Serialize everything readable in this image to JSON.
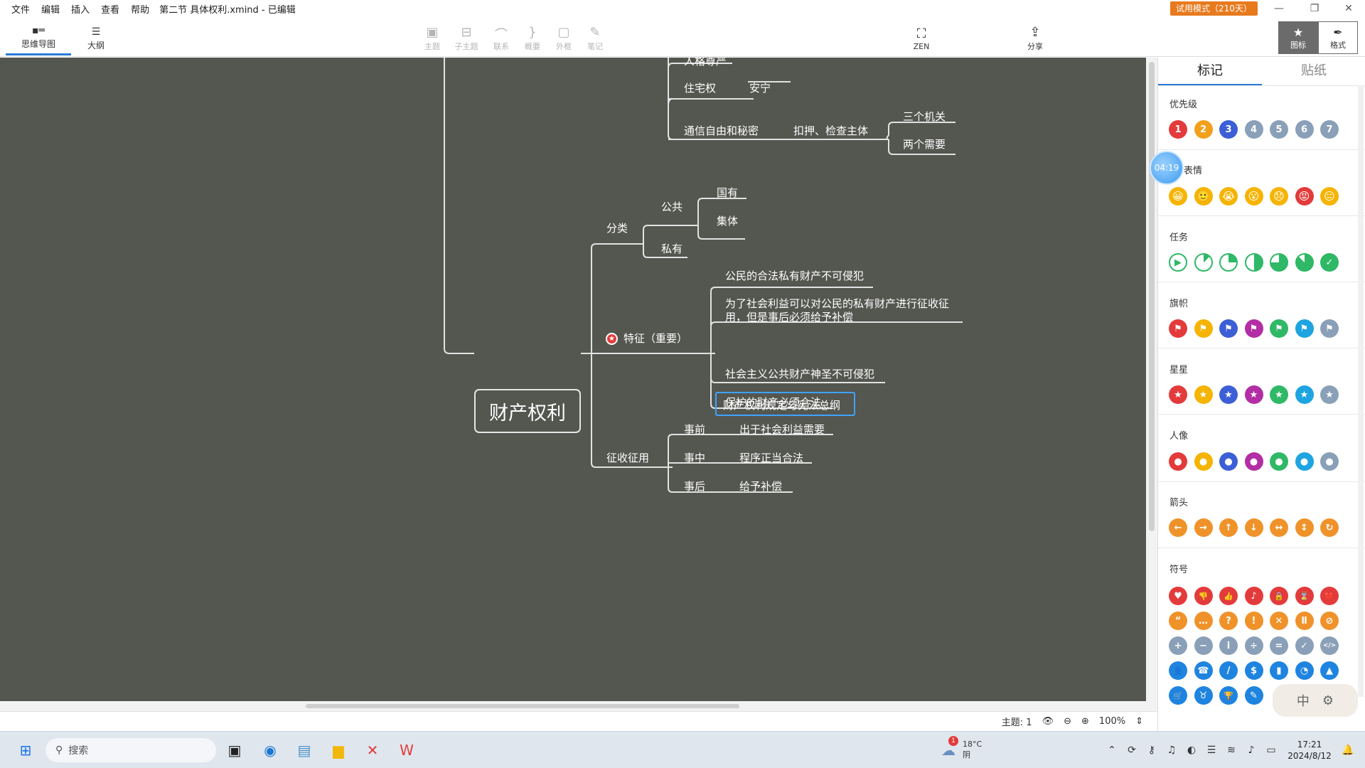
{
  "menubar": {
    "items": [
      "文件",
      "编辑",
      "插入",
      "查看",
      "帮助"
    ],
    "doc_title": "第二节 具体权利.xmind - 已编辑",
    "trial_badge": "试用模式（210天）"
  },
  "toolbar": {
    "view_tabs": [
      {
        "label": "思维导图",
        "icon": "mindmap-icon",
        "active": true
      },
      {
        "label": "大纲",
        "icon": "outline-icon",
        "active": false
      }
    ],
    "tools": [
      {
        "label": "主题",
        "icon": "topic-icon"
      },
      {
        "label": "子主题",
        "icon": "subtopic-icon"
      },
      {
        "label": "联系",
        "icon": "relationship-icon"
      },
      {
        "label": "概要",
        "icon": "summary-icon"
      },
      {
        "label": "外框",
        "icon": "boundary-icon"
      },
      {
        "label": "笔记",
        "icon": "note-icon"
      }
    ],
    "zen_label": "ZEN",
    "share_label": "分享",
    "icon_panel_label": "图标",
    "format_panel_label": "格式"
  },
  "map": {
    "central": "财产权利",
    "nodes": {
      "renge": "人格尊严",
      "zhuzhai": "住宅权",
      "anning": "安宁",
      "tongxin": "通信自由和秘密",
      "kouya": "扣押、检查主体",
      "sange": "三个机关",
      "liangge": "两个需要",
      "fenlei": "分类",
      "gonggong": "公共",
      "guoyou": "国有",
      "jiti": "集体",
      "siyou": "私有",
      "tezheng": "特征（重要）",
      "t1": "公民的合法私有财产不可侵犯",
      "t2": "为了社会利益可以对公民的私有财产进行征收征用，但是事后必须给予补偿",
      "t3": "财产权利规定与宪法总纲",
      "t4": "社会主义公共财产神圣不可侵犯",
      "t5": "保护的财产必须合法",
      "zhengshou": "征收征用",
      "shiqian": "事前",
      "shiqian_v": "出于社会利益需要",
      "shizhong": "事中",
      "shizhong_v": "程序正当合法",
      "shihou": "事后",
      "shihou_v": "给予补偿"
    }
  },
  "statusbar": {
    "topic_count": "主题: 1",
    "zoom": "100%"
  },
  "panel": {
    "tabs": [
      "标记",
      "贴纸"
    ],
    "sections": [
      {
        "title": "优先级",
        "type": "priority",
        "items": [
          "1",
          "2",
          "3",
          "4",
          "5",
          "6",
          "7"
        ],
        "colors": [
          "#e33b3b",
          "#f2a01c",
          "#3c5fd6",
          "#8aa0b8",
          "#8aa0b8",
          "#8aa0b8",
          "#8aa0b8"
        ]
      },
      {
        "title": "表情",
        "type": "smiley",
        "items": [
          "😀",
          "🙂",
          "😭",
          "😮",
          "😞",
          "😡",
          "😐"
        ]
      },
      {
        "title": "任务",
        "type": "task",
        "items": [
          "start",
          "1/8",
          "1/4",
          "1/2",
          "3/4",
          "7/8",
          "done"
        ]
      },
      {
        "title": "旗帜",
        "type": "flag",
        "colors": [
          "#e33b3b",
          "#f5b400",
          "#3c5fd6",
          "#b32ea5",
          "#2fb866",
          "#1ea4e0",
          "#8aa0b8"
        ]
      },
      {
        "title": "星星",
        "type": "star",
        "colors": [
          "#e33b3b",
          "#f5b400",
          "#3c5fd6",
          "#b32ea5",
          "#2fb866",
          "#1ea4e0",
          "#8aa0b8"
        ]
      },
      {
        "title": "人像",
        "type": "person",
        "colors": [
          "#e33b3b",
          "#f5b400",
          "#3c5fd6",
          "#b32ea5",
          "#2fb866",
          "#1ea4e0",
          "#8aa0b8"
        ]
      },
      {
        "title": "箭头",
        "type": "arrow",
        "items": [
          "←",
          "→",
          "↑",
          "↓",
          "↔",
          "↕",
          "↻"
        ]
      },
      {
        "title": "符号",
        "type": "symbol"
      }
    ],
    "symbol_rows": [
      {
        "color": "#e33b3b",
        "items": [
          "♥",
          "👎",
          "👍",
          "♪",
          "🔒",
          "⌛",
          "💔"
        ]
      },
      {
        "color": "#f0922a",
        "items": [
          "“",
          "…",
          "?",
          "!",
          "✕",
          "Ⅱ",
          "⊘"
        ]
      },
      {
        "color": "#8aa0b8",
        "items": [
          "+",
          "−",
          "i",
          "÷",
          "=",
          "✓",
          "</>"
        ]
      },
      {
        "color": "#1e84e0",
        "items": [
          "👤",
          "☎",
          "/",
          "$",
          "▮",
          "◔",
          "▲"
        ]
      },
      {
        "color": "#1e84e0",
        "items": [
          "🛒",
          "♉",
          "🏆",
          "✎"
        ]
      }
    ]
  },
  "overlays": {
    "timer": "04:19",
    "ime": "中"
  },
  "taskbar": {
    "search_placeholder": "搜索",
    "weather_temp": "18°C",
    "weather_desc": "阴",
    "weather_badge": "1",
    "time": "17:21",
    "date": "2024/8/12"
  }
}
